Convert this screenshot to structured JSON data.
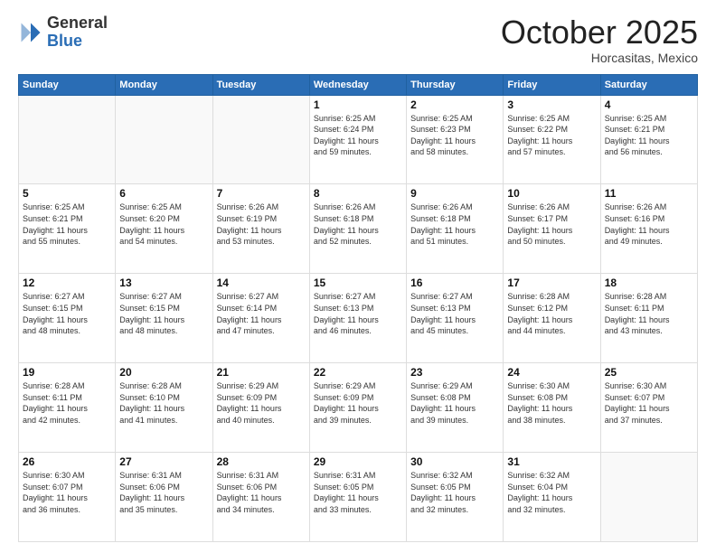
{
  "header": {
    "logo_general": "General",
    "logo_blue": "Blue",
    "month_title": "October 2025",
    "location": "Horcasitas, Mexico"
  },
  "days_of_week": [
    "Sunday",
    "Monday",
    "Tuesday",
    "Wednesday",
    "Thursday",
    "Friday",
    "Saturday"
  ],
  "weeks": [
    [
      {
        "day": "",
        "info": ""
      },
      {
        "day": "",
        "info": ""
      },
      {
        "day": "",
        "info": ""
      },
      {
        "day": "1",
        "info": "Sunrise: 6:25 AM\nSunset: 6:24 PM\nDaylight: 11 hours\nand 59 minutes."
      },
      {
        "day": "2",
        "info": "Sunrise: 6:25 AM\nSunset: 6:23 PM\nDaylight: 11 hours\nand 58 minutes."
      },
      {
        "day": "3",
        "info": "Sunrise: 6:25 AM\nSunset: 6:22 PM\nDaylight: 11 hours\nand 57 minutes."
      },
      {
        "day": "4",
        "info": "Sunrise: 6:25 AM\nSunset: 6:21 PM\nDaylight: 11 hours\nand 56 minutes."
      }
    ],
    [
      {
        "day": "5",
        "info": "Sunrise: 6:25 AM\nSunset: 6:21 PM\nDaylight: 11 hours\nand 55 minutes."
      },
      {
        "day": "6",
        "info": "Sunrise: 6:25 AM\nSunset: 6:20 PM\nDaylight: 11 hours\nand 54 minutes."
      },
      {
        "day": "7",
        "info": "Sunrise: 6:26 AM\nSunset: 6:19 PM\nDaylight: 11 hours\nand 53 minutes."
      },
      {
        "day": "8",
        "info": "Sunrise: 6:26 AM\nSunset: 6:18 PM\nDaylight: 11 hours\nand 52 minutes."
      },
      {
        "day": "9",
        "info": "Sunrise: 6:26 AM\nSunset: 6:18 PM\nDaylight: 11 hours\nand 51 minutes."
      },
      {
        "day": "10",
        "info": "Sunrise: 6:26 AM\nSunset: 6:17 PM\nDaylight: 11 hours\nand 50 minutes."
      },
      {
        "day": "11",
        "info": "Sunrise: 6:26 AM\nSunset: 6:16 PM\nDaylight: 11 hours\nand 49 minutes."
      }
    ],
    [
      {
        "day": "12",
        "info": "Sunrise: 6:27 AM\nSunset: 6:15 PM\nDaylight: 11 hours\nand 48 minutes."
      },
      {
        "day": "13",
        "info": "Sunrise: 6:27 AM\nSunset: 6:15 PM\nDaylight: 11 hours\nand 48 minutes."
      },
      {
        "day": "14",
        "info": "Sunrise: 6:27 AM\nSunset: 6:14 PM\nDaylight: 11 hours\nand 47 minutes."
      },
      {
        "day": "15",
        "info": "Sunrise: 6:27 AM\nSunset: 6:13 PM\nDaylight: 11 hours\nand 46 minutes."
      },
      {
        "day": "16",
        "info": "Sunrise: 6:27 AM\nSunset: 6:13 PM\nDaylight: 11 hours\nand 45 minutes."
      },
      {
        "day": "17",
        "info": "Sunrise: 6:28 AM\nSunset: 6:12 PM\nDaylight: 11 hours\nand 44 minutes."
      },
      {
        "day": "18",
        "info": "Sunrise: 6:28 AM\nSunset: 6:11 PM\nDaylight: 11 hours\nand 43 minutes."
      }
    ],
    [
      {
        "day": "19",
        "info": "Sunrise: 6:28 AM\nSunset: 6:11 PM\nDaylight: 11 hours\nand 42 minutes."
      },
      {
        "day": "20",
        "info": "Sunrise: 6:28 AM\nSunset: 6:10 PM\nDaylight: 11 hours\nand 41 minutes."
      },
      {
        "day": "21",
        "info": "Sunrise: 6:29 AM\nSunset: 6:09 PM\nDaylight: 11 hours\nand 40 minutes."
      },
      {
        "day": "22",
        "info": "Sunrise: 6:29 AM\nSunset: 6:09 PM\nDaylight: 11 hours\nand 39 minutes."
      },
      {
        "day": "23",
        "info": "Sunrise: 6:29 AM\nSunset: 6:08 PM\nDaylight: 11 hours\nand 39 minutes."
      },
      {
        "day": "24",
        "info": "Sunrise: 6:30 AM\nSunset: 6:08 PM\nDaylight: 11 hours\nand 38 minutes."
      },
      {
        "day": "25",
        "info": "Sunrise: 6:30 AM\nSunset: 6:07 PM\nDaylight: 11 hours\nand 37 minutes."
      }
    ],
    [
      {
        "day": "26",
        "info": "Sunrise: 6:30 AM\nSunset: 6:07 PM\nDaylight: 11 hours\nand 36 minutes."
      },
      {
        "day": "27",
        "info": "Sunrise: 6:31 AM\nSunset: 6:06 PM\nDaylight: 11 hours\nand 35 minutes."
      },
      {
        "day": "28",
        "info": "Sunrise: 6:31 AM\nSunset: 6:06 PM\nDaylight: 11 hours\nand 34 minutes."
      },
      {
        "day": "29",
        "info": "Sunrise: 6:31 AM\nSunset: 6:05 PM\nDaylight: 11 hours\nand 33 minutes."
      },
      {
        "day": "30",
        "info": "Sunrise: 6:32 AM\nSunset: 6:05 PM\nDaylight: 11 hours\nand 32 minutes."
      },
      {
        "day": "31",
        "info": "Sunrise: 6:32 AM\nSunset: 6:04 PM\nDaylight: 11 hours\nand 32 minutes."
      },
      {
        "day": "",
        "info": ""
      }
    ]
  ]
}
